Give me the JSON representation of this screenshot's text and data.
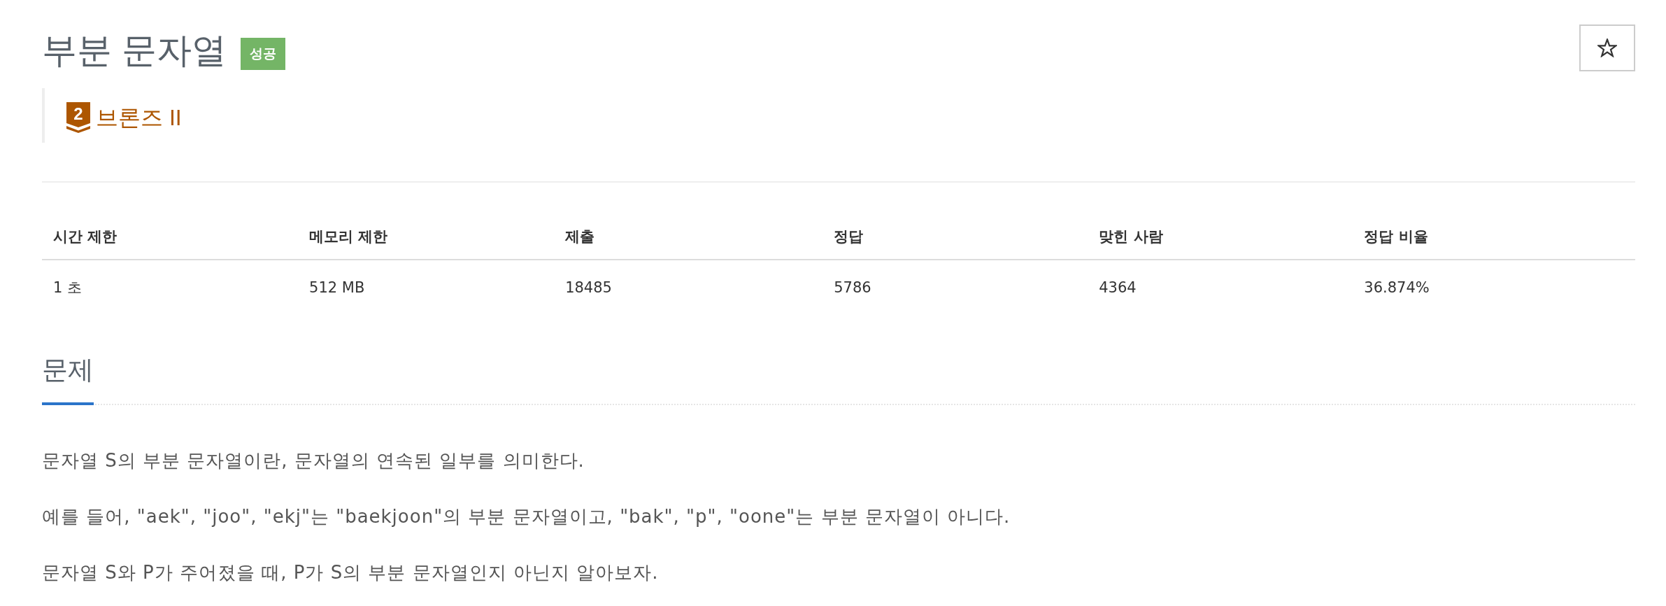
{
  "problem": {
    "title": "부분 문자열",
    "result_badge": {
      "kind": "success",
      "label": "성공"
    },
    "favorite": {
      "starred": false
    }
  },
  "tier": {
    "kind": "bronze",
    "level": "2",
    "name": "브론즈 II"
  },
  "table": {
    "columns": [
      "시간 제한",
      "메모리 제한",
      "제출",
      "정답",
      "맞힌 사람",
      "정답 비율"
    ],
    "rows": [
      [
        "1 초",
        "512 MB",
        "18485",
        "5786",
        "4364",
        "36.874%"
      ]
    ]
  },
  "section": {
    "title": "문제",
    "paragraphs": [
      "문자열 S의 부분 문자열이란, 문자열의 연속된 일부를 의미한다.",
      "예를 들어, \"aek\", \"joo\", \"ekj\"는 \"baekjoon\"의 부분 문자열이고, \"bak\", \"p\", \"oone\"는 부분 문자열이 아니다.",
      "문자열 S와 P가 주어졌을 때, P가 S의 부분 문자열인지 아닌지 알아보자."
    ]
  }
}
